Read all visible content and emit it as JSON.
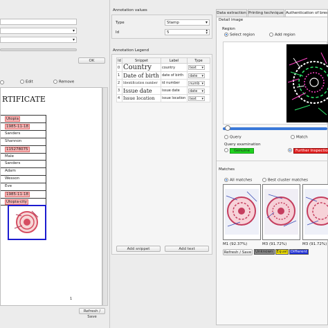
{
  "left": {
    "ok_label": "OK",
    "toolbar": {
      "edit_label": "Edit",
      "remove_label": "Remove"
    },
    "document": {
      "title_fragment": "RTIFICATE",
      "rows": [
        {
          "value": "Utopia",
          "highlight": true
        },
        {
          "value": "1985-11-18",
          "highlight": true
        },
        {
          "value": "Sanders",
          "highlight": false
        },
        {
          "value": "Shannon",
          "highlight": false
        },
        {
          "value": "115278075",
          "highlight": true
        },
        {
          "value": "Male",
          "highlight": false
        },
        {
          "value": "Sanders",
          "highlight": false
        },
        {
          "value": "Adam",
          "highlight": false
        },
        {
          "value": "Wesson",
          "highlight": false
        },
        {
          "value": "Eve",
          "highlight": false
        },
        {
          "value": "1985-11-18",
          "highlight": true
        },
        {
          "value": "Utopia-city",
          "highlight": true
        }
      ],
      "page_number": "1"
    },
    "refresh_save_label": "Refresh / Save"
  },
  "middle": {
    "annotation_values_title": "Annotation values",
    "type_label": "Type",
    "type_value": "Stamp",
    "id_label": "Id",
    "id_value": "5",
    "legend_title": "Annotation Legend",
    "legend_headers": [
      "Id",
      "Snippet",
      "Label",
      "Type"
    ],
    "legend_rows": [
      {
        "id": "0",
        "snippet": "Country",
        "label": "country",
        "type": "text",
        "size": "big"
      },
      {
        "id": "1",
        "snippet": "Date of birth",
        "label": "date of birth",
        "type": "date",
        "size": "med"
      },
      {
        "id": "2",
        "snippet": "Identification number",
        "label": "id number",
        "type": "numb",
        "size": "small"
      },
      {
        "id": "3",
        "snippet": "Issue date",
        "label": "issue date",
        "type": "date",
        "size": "med"
      },
      {
        "id": "4",
        "snippet": "Issue location",
        "label": "issue location",
        "type": "text",
        "size": "med2"
      }
    ],
    "add_snippet_label": "Add snippet",
    "add_text_label": "Add text"
  },
  "right": {
    "tabs": [
      "Data extraction",
      "Printing techniques",
      "Authentication of breeder"
    ],
    "active_tab": 2,
    "detail_image_label": "Detail image",
    "region_label": "Region",
    "select_region_label": "Select region",
    "add_region_label": "Add region",
    "slider_fraction": 0.02,
    "query_label": "Query",
    "match_label": "Match",
    "query_examination_label": "Query examination",
    "genuine_label": "Genuine",
    "further_inspection_label": "Further Inspection",
    "matches_label": "Matches",
    "all_matches_label": "All matches",
    "best_cluster_label": "Best cluster matches",
    "captions": [
      "M1 (92.37%)",
      "M3 (91.72%)",
      "M3 (91.72%)"
    ],
    "refresh_save_label": "Refresh / Save",
    "legend_items": [
      {
        "label": "Unknown",
        "color": "#8a8a8a"
      },
      {
        "label": "Equal",
        "color": "#f5e400"
      },
      {
        "label": "Different",
        "color": "#1e2fd6"
      }
    ]
  },
  "colors": {
    "genuine": "#1fd21f",
    "further": "#e01d1d",
    "stamp_border": "#1b1bd0",
    "highlight": "#f7b5b5"
  }
}
